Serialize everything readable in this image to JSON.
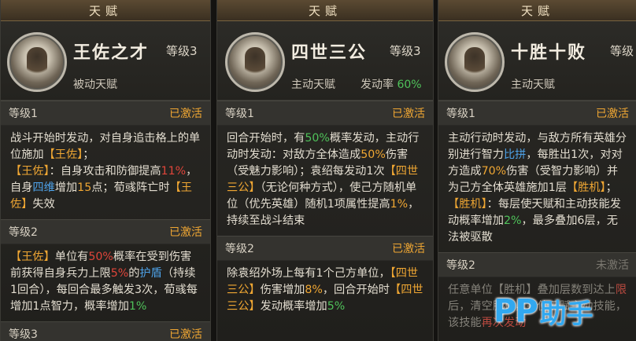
{
  "panels": [
    {
      "title": "天赋",
      "name": "王佐之才",
      "level": "等级3",
      "type": "被动天赋",
      "sections": [
        {
          "label": "等级1",
          "status": "已激活"
        },
        {
          "label": "等级2",
          "status": "已激活"
        },
        {
          "label": "等级3",
          "status": "已激活"
        }
      ]
    },
    {
      "title": "天赋",
      "name": "四世三公",
      "level": "等级3",
      "type": "主动天赋",
      "rate_label": "发动率",
      "rate_value": "60%",
      "sections": [
        {
          "label": "等级1",
          "status": "已激活"
        },
        {
          "label": "等级2",
          "status": "已激活"
        }
      ]
    },
    {
      "title": "天赋",
      "name": "十胜十败",
      "level": "等级",
      "type": "主动天赋",
      "sections": [
        {
          "label": "等级1",
          "status": "已激活"
        },
        {
          "label": "等级2",
          "status": "未激活"
        }
      ]
    }
  ],
  "t": {
    "a1_1": "战斗开始时发动，对自身追击格上的单位施加",
    "a1_2": "【王佐】",
    "a1_3": "；",
    "a1_4": "【王佐】",
    "a1_5": "：自身攻击和防御提高",
    "a1_6": "11%",
    "a1_7": "，自身",
    "a1_8": "四维",
    "a1_9": "增加",
    "a1_10": "15",
    "a1_11": "点；荀彧阵亡时",
    "a1_12": "【王佐】",
    "a1_13": "失效",
    "a2_1": "【王佐】",
    "a2_2": "单位有",
    "a2_3": "50%",
    "a2_4": "概率在受到伤害前获得自身兵力上限",
    "a2_5": "5%",
    "a2_6": "的",
    "a2_7": "护盾",
    "a2_8": "（持续1回合），每回合最多触发3次，荀彧每增加1点智力，概率增加",
    "a2_9": "1%",
    "b1_1": "回合开始时，有",
    "b1_2": "50%",
    "b1_3": "概率发动，主动行动时发动：对敌方全体造成",
    "b1_4": "50%",
    "b1_5": "伤害（受魅力影响）；袁绍每发动1次",
    "b1_6": "【四世三公】",
    "b1_7": "（无论何种方式），使己方随机单位（优先英雄）随机1项属性提高",
    "b1_8": "1%",
    "b1_9": "，持续至战斗结束",
    "b2_1": "除袁绍外场上每有1个己方单位，",
    "b2_2": "【四世三公】",
    "b2_3": "伤害增加",
    "b2_4": "8%",
    "b2_5": "，回合开始时",
    "b2_6": "【四世三公】",
    "b2_7": "发动概率增加",
    "b2_8": "5%",
    "c1_1": "主动行动时发动，与敌方所有英雄分别进行智力",
    "c1_2": "比拼",
    "c1_3": "，每胜出1次，对对方造成",
    "c1_4": "70%",
    "c1_5": "伤害（受智力影响）并为己方全体英雄施加1层",
    "c1_6": "【胜机】",
    "c1_7": "；",
    "c1_8": "【胜机】",
    "c1_9": "：每层使天赋和主动技能发动概率增加",
    "c1_10": "2%",
    "c1_11": "，最多叠加6层，无法被驱散",
    "c2_1": "任意单位",
    "c2_2": "【胜机】",
    "c2_3": "叠加层数到达上",
    "c2_4": "限",
    "c2_5": "后，清空胜机，并使天赋主动技能",
    "c2_6": "再次发动",
    "c2_7": "，该技能"
  },
  "watermark": {
    "pp": "PP",
    "zh": "助手"
  },
  "colors": {
    "orange": "#f0a733",
    "green": "#4fc25a",
    "blue": "#4ea2e8",
    "red": "#e0453a"
  }
}
